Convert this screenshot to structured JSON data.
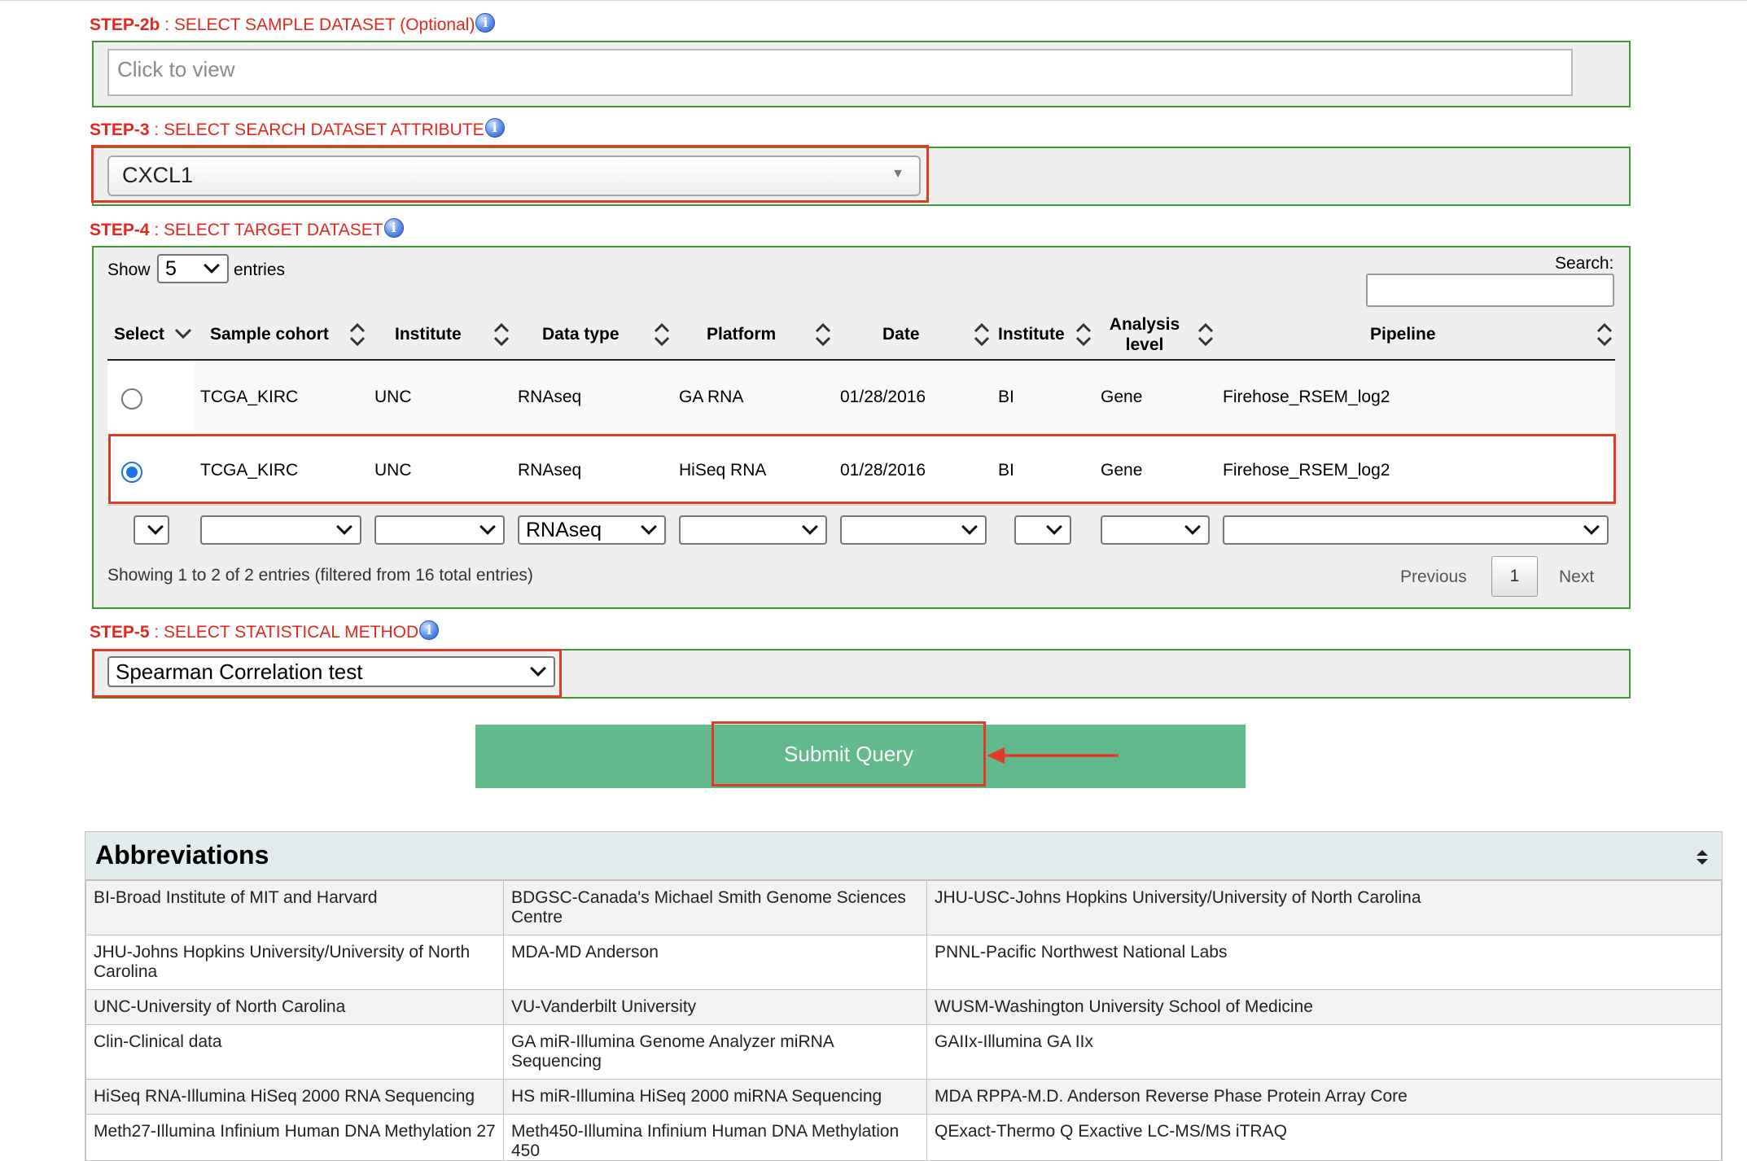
{
  "steps": {
    "s2b": {
      "prefix": "STEP-2b",
      "label": " : SELECT SAMPLE DATASET (Optional)",
      "placeholder": "Click to view"
    },
    "s3": {
      "prefix": "STEP-3",
      "label": " : SELECT SEARCH DATASET ATTRIBUTE",
      "value": "CXCL1"
    },
    "s4": {
      "prefix": "STEP-4",
      "label": " : SELECT TARGET DATASET"
    },
    "s5": {
      "prefix": "STEP-5",
      "label": " : SELECT STATISTICAL METHOD",
      "value": "Spearman Correlation test"
    }
  },
  "table": {
    "show_label": "Show",
    "entries_value": "5",
    "entries_label": "entries",
    "search_label": "Search:",
    "columns": [
      "Select",
      "Sample cohort",
      "Institute",
      "Data type",
      "Platform",
      "Date",
      "Institute",
      "Analysis level",
      "Pipeline"
    ],
    "rows": [
      {
        "selected": false,
        "cells": [
          "TCGA_KIRC",
          "UNC",
          "RNAseq",
          "GA RNA",
          "01/28/2016",
          "BI",
          "Gene",
          "Firehose_RSEM_log2"
        ]
      },
      {
        "selected": true,
        "cells": [
          "TCGA_KIRC",
          "UNC",
          "RNAseq",
          "HiSeq RNA",
          "01/28/2016",
          "BI",
          "Gene",
          "Firehose_RSEM_log2"
        ]
      }
    ],
    "filters": [
      "",
      "",
      "",
      "RNAseq",
      "",
      "",
      "",
      "",
      ""
    ],
    "info": "Showing 1 to 2 of 2 entries (filtered from 16 total entries)",
    "pagination": {
      "previous": "Previous",
      "page": "1",
      "next": "Next"
    }
  },
  "submit_label": "Submit Query",
  "abbreviations": {
    "title": "Abbreviations",
    "rows": [
      [
        "BI-Broad Institute of MIT and Harvard",
        "BDGSC-Canada's Michael Smith Genome Sciences Centre",
        "JHU-USC-Johns Hopkins University/University of North Carolina"
      ],
      [
        "JHU-Johns Hopkins University/University of North Carolina",
        "MDA-MD Anderson",
        "PNNL-Pacific Northwest National Labs"
      ],
      [
        "UNC-University of North Carolina",
        "VU-Vanderbilt University",
        "WUSM-Washington University School of Medicine"
      ],
      [
        "Clin-Clinical data",
        "GA miR-Illumina Genome Analyzer miRNA Sequencing",
        "GAIIx-Illumina GA IIx"
      ],
      [
        "HiSeq RNA-Illumina HiSeq 2000 RNA Sequencing",
        "HS miR-Illumina HiSeq 2000 miRNA Sequencing",
        "MDA RPPA-M.D. Anderson Reverse Phase Protein Array Core"
      ],
      [
        "Meth27-Illumina Infinium Human DNA Methylation 27",
        "Meth450-Illumina Infinium Human DNA Methylation 450",
        "QExact-Thermo Q Exactive LC-MS/MS iTRAQ"
      ]
    ]
  },
  "colors": {
    "step_label": "#e2281c",
    "panel_border": "#3f9a36",
    "highlight": "#e23b25",
    "submit_bg": "#62b98c",
    "radio_selected": "#1a73e8"
  },
  "icons": [
    "info-icon",
    "chevron-down-icon",
    "sort-icon",
    "dropdown-triangle-icon",
    "sort-toggle-icon",
    "arrow-annotation"
  ]
}
